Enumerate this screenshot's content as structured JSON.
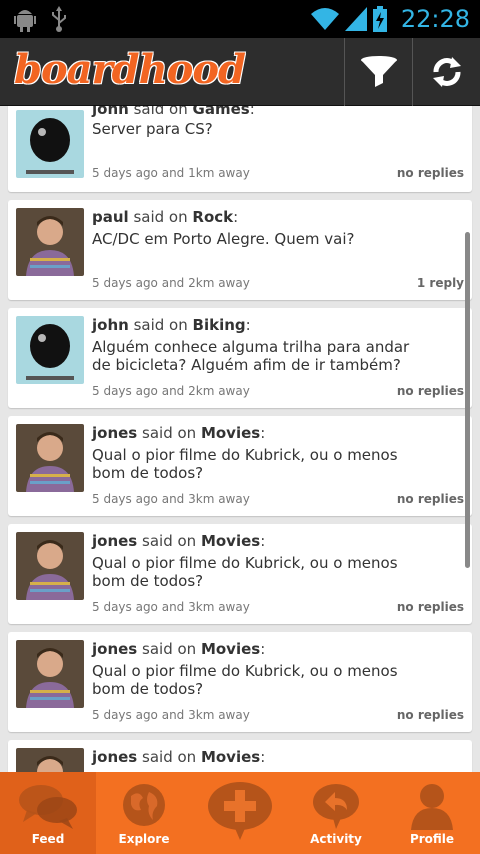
{
  "status_bar": {
    "time": "22:28"
  },
  "header": {
    "logo_text": "boardhood"
  },
  "feed": [
    {
      "user": "john",
      "verb": "said on",
      "topic": "Games",
      "message": "Server para CS?",
      "meta": "5 days ago and 1km away",
      "replies": "no replies",
      "avatar": "poster"
    },
    {
      "user": "paul",
      "verb": "said on",
      "topic": "Rock",
      "message": "AC/DC em Porto Alegre. Quem vai?",
      "meta": "5 days ago and 2km away",
      "replies": "1 reply",
      "avatar": "person"
    },
    {
      "user": "john",
      "verb": "said on",
      "topic": "Biking",
      "message": "Alguém conhece alguma trilha para andar de bicicleta? Alguém afim de ir também?",
      "meta": "5 days ago and 2km away",
      "replies": "no replies",
      "avatar": "poster"
    },
    {
      "user": "jones",
      "verb": "said on",
      "topic": "Movies",
      "message": "Qual o pior filme do Kubrick, ou o menos bom de todos?",
      "meta": "5 days ago and 3km away",
      "replies": "no replies",
      "avatar": "person"
    },
    {
      "user": "jones",
      "verb": "said on",
      "topic": "Movies",
      "message": "Qual o pior filme do Kubrick, ou o menos bom de todos?",
      "meta": "5 days ago and 3km away",
      "replies": "no replies",
      "avatar": "person"
    },
    {
      "user": "jones",
      "verb": "said on",
      "topic": "Movies",
      "message": "Qual o pior filme do Kubrick, ou o menos bom de todos?",
      "meta": "5 days ago and 3km away",
      "replies": "no replies",
      "avatar": "person"
    },
    {
      "user": "jones",
      "verb": "said on",
      "topic": "Movies",
      "message": "",
      "meta": "",
      "replies": "",
      "avatar": "person"
    }
  ],
  "bottom_nav": [
    {
      "label": "Feed",
      "icon": "chat-bubbles-icon",
      "active": true
    },
    {
      "label": "Explore",
      "icon": "globe-icon",
      "active": false
    },
    {
      "label": "",
      "icon": "add-post-icon",
      "active": false
    },
    {
      "label": "Activity",
      "icon": "reply-bubble-icon",
      "active": false
    },
    {
      "label": "Profile",
      "icon": "person-icon",
      "active": false
    }
  ],
  "colors": {
    "accent": "#f37021",
    "header_bg": "#2d2d2d",
    "status_blue": "#33b5e5"
  }
}
